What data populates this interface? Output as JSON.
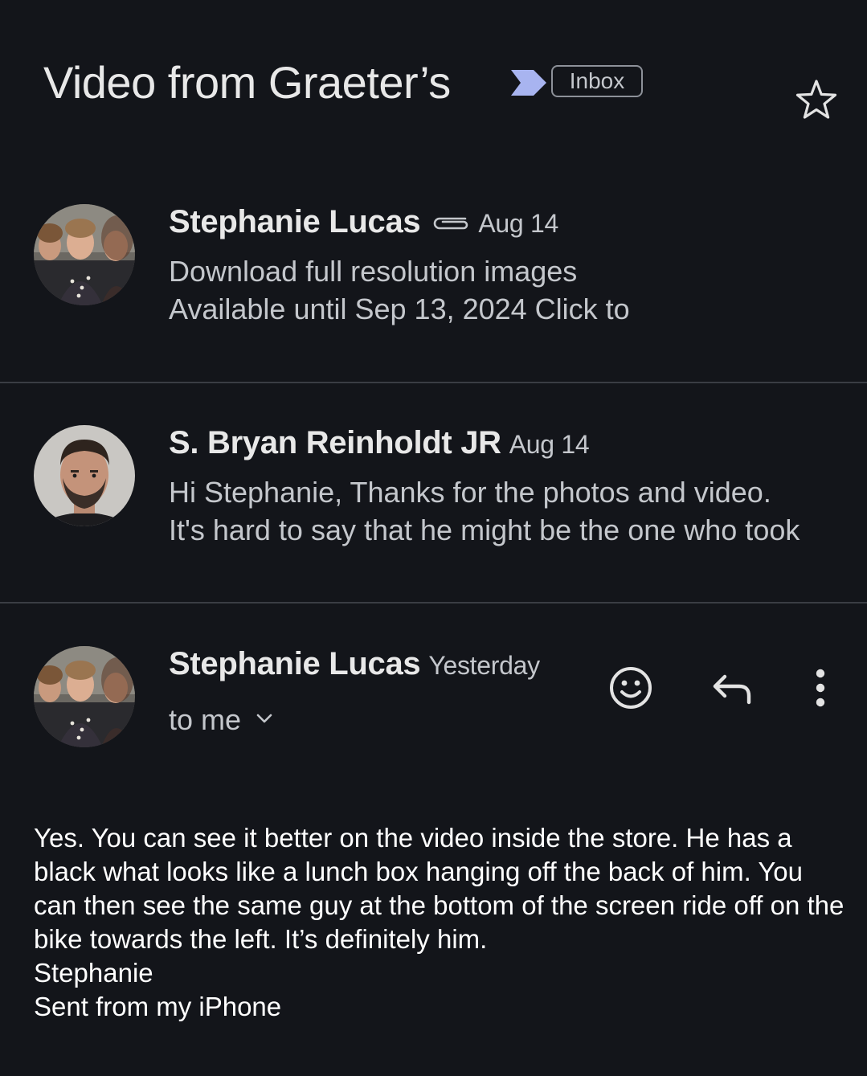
{
  "subject": {
    "title": "Video from Graeter’s",
    "label": "Inbox"
  },
  "icons": {
    "importance": "importance-marker-icon",
    "star": "star-outline-icon",
    "attachment": "paperclip-icon",
    "emoji": "emoji-smile-icon",
    "reply": "reply-icon",
    "more": "more-vert-icon",
    "expand": "chevron-down-icon"
  },
  "colors": {
    "background": "#13151a",
    "importance": "#a8b4f0",
    "text_primary": "#e8e8e8",
    "text_secondary": "#c4c7cc"
  },
  "messages": [
    {
      "sender": "Stephanie Lucas",
      "date": "Aug 14",
      "has_attachment": true,
      "snippet_line1": "Download full resolution images",
      "snippet_line2": "Available until Sep 13, 2024 Click to"
    },
    {
      "sender": "S. Bryan Reinholdt JR",
      "date": "Aug 14",
      "has_attachment": false,
      "snippet_line1": "Hi Stephanie, Thanks for the photos and video.",
      "snippet_line2": "It's hard to say that he might be the one who took"
    },
    {
      "sender": "Stephanie Lucas",
      "date": "Yesterday",
      "recipient": "to me",
      "body": [
        "Yes. You can see it better on the video inside the store. He has a black what looks like a lunch box hanging off the back of him. You can then see the same guy at the bottom of the screen ride off on the bike towards the left. It’s definitely him.",
        "Stephanie",
        "Sent from my iPhone"
      ]
    }
  ]
}
